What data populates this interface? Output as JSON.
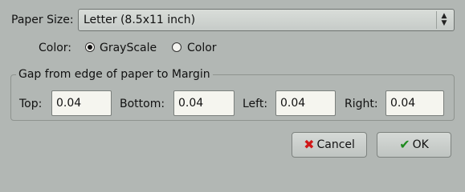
{
  "paper_size": {
    "label": "Paper Size:",
    "value": "Letter (8.5x11 inch)",
    "icon": "updown-arrows-icon"
  },
  "color": {
    "label": "Color:",
    "options": [
      {
        "label": "GrayScale",
        "checked": true
      },
      {
        "label": "Color",
        "checked": false
      }
    ]
  },
  "gap_group": {
    "title": "Gap from edge of paper to Margin",
    "fields": {
      "top": {
        "label": "Top:",
        "value": "0.04"
      },
      "bottom": {
        "label": "Bottom:",
        "value": "0.04"
      },
      "left": {
        "label": "Left:",
        "value": "0.04"
      },
      "right": {
        "label": "Right:",
        "value": "0.04"
      }
    }
  },
  "buttons": {
    "cancel": {
      "label": "Cancel",
      "icon": "red-x-icon",
      "color": "#d01818"
    },
    "ok": {
      "label": "OK",
      "icon": "green-check-icon",
      "color": "#1e8a1e"
    }
  }
}
